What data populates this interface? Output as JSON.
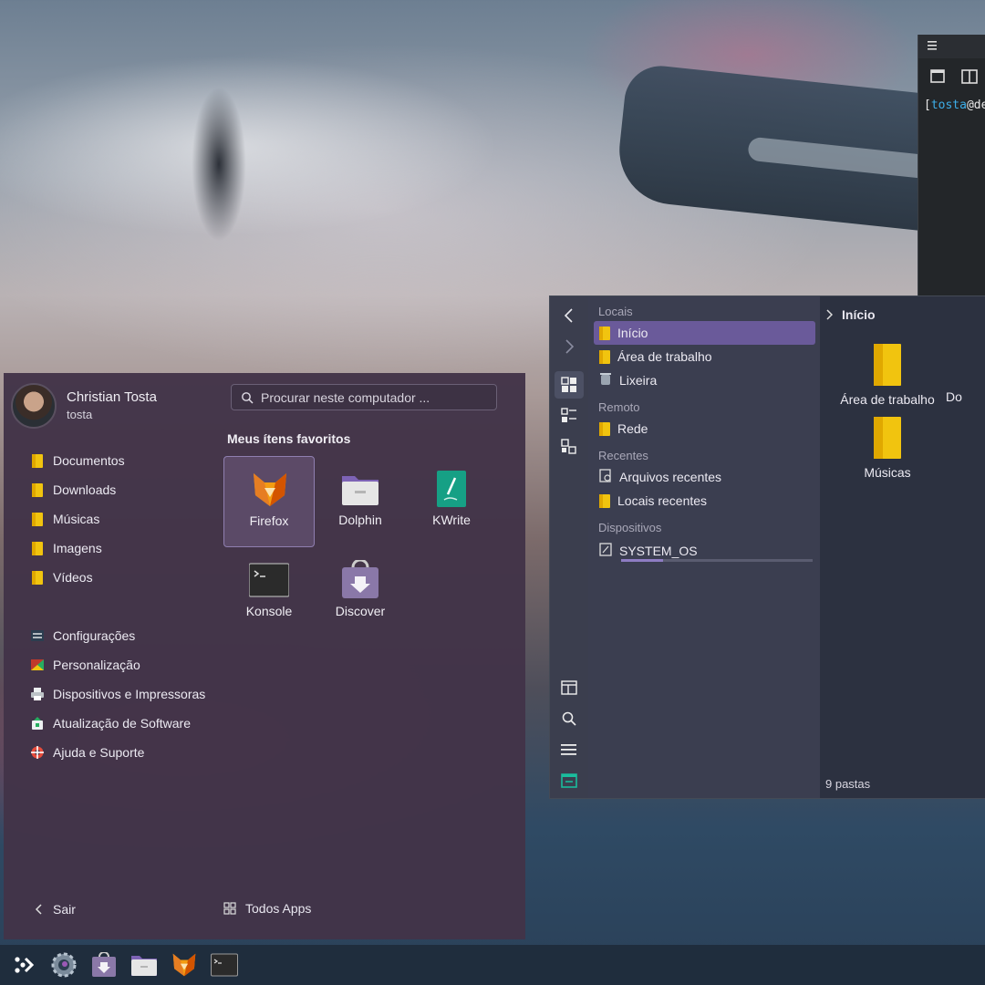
{
  "terminal": {
    "prompt_user": "tosta",
    "prompt_rest": "@dee",
    "prompt_open": "["
  },
  "dolphin": {
    "places": {
      "sections": [
        {
          "title": "Locais",
          "items": [
            {
              "label": "Início",
              "icon": "home-folder-icon",
              "selected": true
            },
            {
              "label": "Área de trabalho",
              "icon": "desktop-folder-icon"
            },
            {
              "label": "Lixeira",
              "icon": "trash-icon"
            }
          ]
        },
        {
          "title": "Remoto",
          "items": [
            {
              "label": "Rede",
              "icon": "network-folder-icon"
            }
          ]
        },
        {
          "title": "Recentes",
          "items": [
            {
              "label": "Arquivos recentes",
              "icon": "recent-files-icon"
            },
            {
              "label": "Locais recentes",
              "icon": "recent-places-icon"
            }
          ]
        },
        {
          "title": "Dispositivos",
          "items": [
            {
              "label": "SYSTEM_OS",
              "icon": "drive-icon"
            }
          ]
        }
      ]
    },
    "breadcrumb": "Início",
    "folders": [
      "Área de trabalho",
      "Do",
      "Músicas"
    ],
    "status": "9 pastas"
  },
  "menu": {
    "user_name": "Christian Tosta",
    "user_login": "tosta",
    "search_placeholder": "Procurar neste computador ...",
    "favorites_title": "Meus ítens favoritos",
    "favorites": [
      {
        "label": "Firefox",
        "icon": "firefox-icon",
        "selected": true
      },
      {
        "label": "Dolphin",
        "icon": "dolphin-icon"
      },
      {
        "label": "KWrite",
        "icon": "kwrite-icon"
      },
      {
        "label": "Konsole",
        "icon": "konsole-icon"
      },
      {
        "label": "Discover",
        "icon": "discover-icon"
      }
    ],
    "places": [
      {
        "label": "Documentos",
        "icon": "documents-folder-icon"
      },
      {
        "label": "Downloads",
        "icon": "downloads-folder-icon"
      },
      {
        "label": "Músicas",
        "icon": "music-folder-icon"
      },
      {
        "label": "Imagens",
        "icon": "pictures-folder-icon"
      },
      {
        "label": "Vídeos",
        "icon": "videos-folder-icon"
      }
    ],
    "system": [
      {
        "label": "Configurações",
        "icon": "settings-icon"
      },
      {
        "label": "Personalização",
        "icon": "personalization-icon"
      },
      {
        "label": "Dispositivos e Impressoras",
        "icon": "printer-icon"
      },
      {
        "label": "Atualização de Software",
        "icon": "update-icon"
      },
      {
        "label": "Ajuda e Suporte",
        "icon": "help-icon"
      }
    ],
    "logout_label": "Sair",
    "all_apps_label": "Todos Apps"
  },
  "taskbar": {
    "items": [
      "application-launcher-icon",
      "system-settings-icon",
      "discover-icon",
      "dolphin-icon",
      "firefox-icon",
      "konsole-icon"
    ]
  },
  "colors": {
    "accent": "#6a5a9a",
    "folder": "#f1c40f",
    "panel": "#1f2d3d"
  }
}
